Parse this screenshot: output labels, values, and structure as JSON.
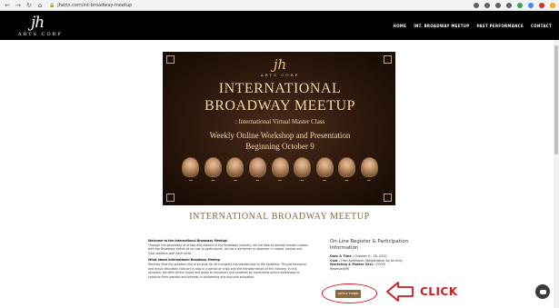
{
  "browser": {
    "url": "jharts.com/int-broadway-meetup",
    "nav_icons": [
      "back-icon",
      "forward-icon",
      "reload-icon",
      "home-icon"
    ],
    "extension_colors": [
      "#5f6368",
      "#5f6368",
      "#5f6368",
      "#5f6368",
      "#34a853",
      "#4285f4",
      "#d93025",
      "#f5a623"
    ]
  },
  "header": {
    "logo_mark": "jh",
    "logo_text": "ARTS CORP",
    "nav": [
      "HOME",
      "INT. BROADWAY MEETUP",
      "PAST PERFORMANCE",
      "CONTACT"
    ]
  },
  "banner": {
    "logo_mark": "jh",
    "logo_text": "ARTS CORP",
    "title_line1": "INTERNATIONAL",
    "title_line2": "BROADWAY MEETUP",
    "subtitle": ": International Virtual Master Class",
    "weekly_line1": "Weekly Online Workshop and Presentation",
    "weekly_line2": "Beginning October 9",
    "portrait_count": 9
  },
  "page_heading": "INTERNATIONAL BROADWAY MEETUP",
  "intro": {
    "welcome_heading": "Welcome to the International Broadway Meetup!",
    "welcome_text": "Through the generosity of artists and leaders in the Broadway industry, we are able to provide master classes with top Broadway artists at no cost to participants, join as a performer or observer in master classes and Q&A sessions with each artist.",
    "about_heading": "What about International Broadway Meetup",
    "about_text": "Recently that the greatest risk of survival for all humanity has passed due to the epidemic. The performance and music education industry is also in a period of crisis and the transformation of the industry. In this situation, we offer online hopes and goals to musicians and students by conducting online workshops to continue their passion and interest in performing arts and arts education."
  },
  "register": {
    "title": "On-Line Register & Participation Information",
    "date_label": "Date & Time :",
    "date_value": "October 9 - 16, 2020",
    "cost_label": "Cost :",
    "cost_value": "Free Admission (Registration by on-line)",
    "workshop_label": "Workshop & Master Sesi :",
    "workshop_value": "ZOOM",
    "extra": "Reserved(M)",
    "apply_label": "APPLY FORM"
  },
  "annotation": {
    "click_text": "CLICK",
    "color": "#d61a1a"
  }
}
